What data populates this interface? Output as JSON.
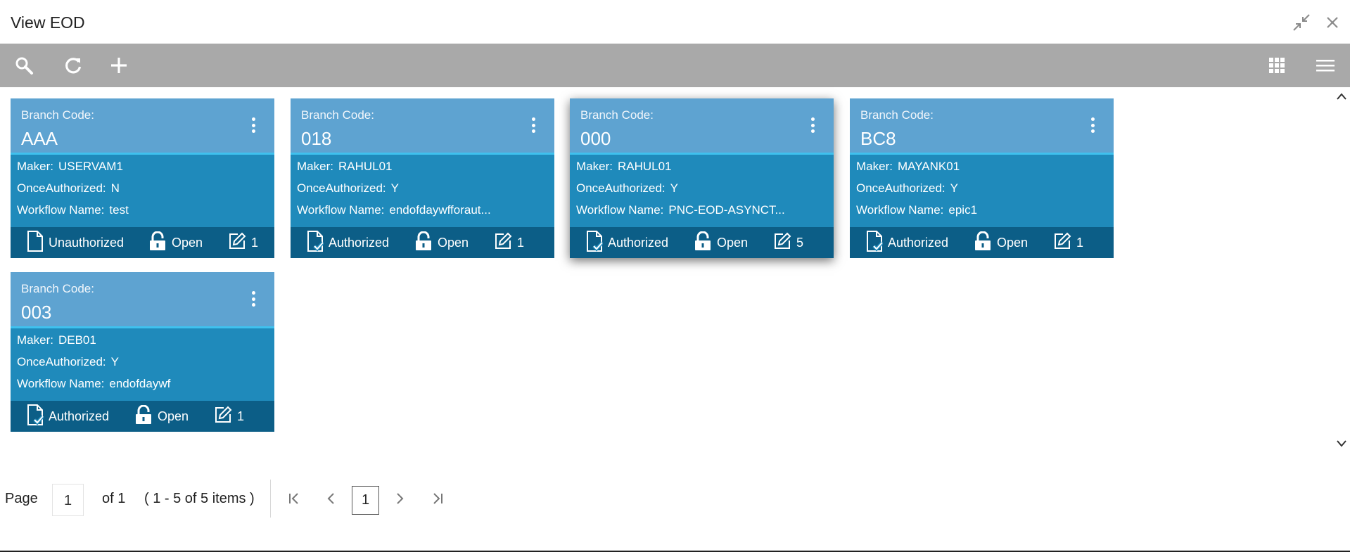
{
  "window": {
    "title": "View EOD"
  },
  "toolbar": {
    "search_icon": "search-icon",
    "refresh_icon": "refresh-icon",
    "add_icon": "add-icon",
    "grid_icon": "grid-view-icon",
    "list_icon": "list-view-icon"
  },
  "labels": {
    "branch_code": "Branch Code:",
    "maker": "Maker:",
    "once_authorized": "OnceAuthorized:",
    "workflow_name": "Workflow Name:",
    "lock_status": "Open"
  },
  "cards": [
    {
      "branch_code": "AAA",
      "maker": "USERVAM1",
      "once_authorized": "N",
      "workflow_name": "test",
      "auth_status": "Unauthorized",
      "lock_status": "Open",
      "modifications": "1"
    },
    {
      "branch_code": "018",
      "maker": "RAHUL01",
      "once_authorized": "Y",
      "workflow_name": "endofdaywfforaut...",
      "auth_status": "Authorized",
      "lock_status": "Open",
      "modifications": "1"
    },
    {
      "branch_code": "000",
      "maker": "RAHUL01",
      "once_authorized": "Y",
      "workflow_name": "PNC-EOD-ASYNCT...",
      "auth_status": "Authorized",
      "lock_status": "Open",
      "modifications": "5"
    },
    {
      "branch_code": "BC8",
      "maker": "MAYANK01",
      "once_authorized": "Y",
      "workflow_name": "epic1",
      "auth_status": "Authorized",
      "lock_status": "Open",
      "modifications": "1"
    },
    {
      "branch_code": "003",
      "maker": "DEB01",
      "once_authorized": "Y",
      "workflow_name": "endofdaywf",
      "auth_status": "Authorized",
      "lock_status": "Open",
      "modifications": "1"
    }
  ],
  "pagination": {
    "page_label": "Page",
    "page_input": "1",
    "of_label": "of 1",
    "items_summary": "( 1 - 5 of 5 items )",
    "current_page": "1"
  },
  "colors": {
    "toolbar": "#a9a9a9",
    "card_header": "#5ea3d1",
    "card_body": "#1f8abb",
    "card_footer": "#0c5e87",
    "header_accent": "#3fc1ee"
  }
}
